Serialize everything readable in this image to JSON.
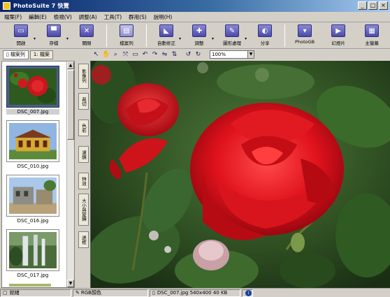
{
  "window": {
    "title": "PhotoSuite 7 快覽",
    "controls": [
      "_",
      "□",
      "×"
    ]
  },
  "menu": [
    "檔案(F)",
    "編輯(E)",
    "檢視(V)",
    "調整(A)",
    "工具(T)",
    "群用(S)",
    "說明(H)"
  ],
  "toolbar": {
    "buttons": [
      {
        "label": "開啟",
        "icon": "open-icon"
      },
      {
        "label": "存檔",
        "icon": "save-icon"
      },
      {
        "label": "關閉",
        "icon": "close-doc-icon"
      },
      {
        "label": "檔案列",
        "icon": "filmstrip-icon",
        "active": true
      },
      {
        "label": "自動修正",
        "icon": "auto-fix-icon"
      },
      {
        "label": "調整",
        "icon": "adjust-icon"
      },
      {
        "label": "圖形處理",
        "icon": "effects-icon"
      },
      {
        "label": "分享",
        "icon": "share-icon"
      },
      {
        "label": "PhotoGB",
        "icon": "photogb-icon"
      },
      {
        "label": "幻燈片",
        "icon": "slideshow-icon"
      },
      {
        "label": "主螢幕",
        "icon": "home-icon"
      }
    ]
  },
  "tabs": [
    {
      "label": "檔案列",
      "selected": true
    },
    {
      "label": "1: 檔案",
      "selected": false
    }
  ],
  "zoom": {
    "value": "100%"
  },
  "thumbnails": [
    {
      "caption": "DSC_007.jpg",
      "selected": true
    },
    {
      "caption": "DSC_010.jpg",
      "selected": false
    },
    {
      "caption": "DSC_016.jpg",
      "selected": false
    },
    {
      "caption": "DSC_017.jpg",
      "selected": false
    }
  ],
  "side_tabs": [
    "影像列",
    "裁切",
    "色彩",
    "濾鏡",
    "特效",
    "大小與旋轉",
    "邊框"
  ],
  "status": {
    "left": "就緒",
    "color_mode": "RGB顏色",
    "file_info": "DSC_007.jpg 540x400 40 KB"
  }
}
